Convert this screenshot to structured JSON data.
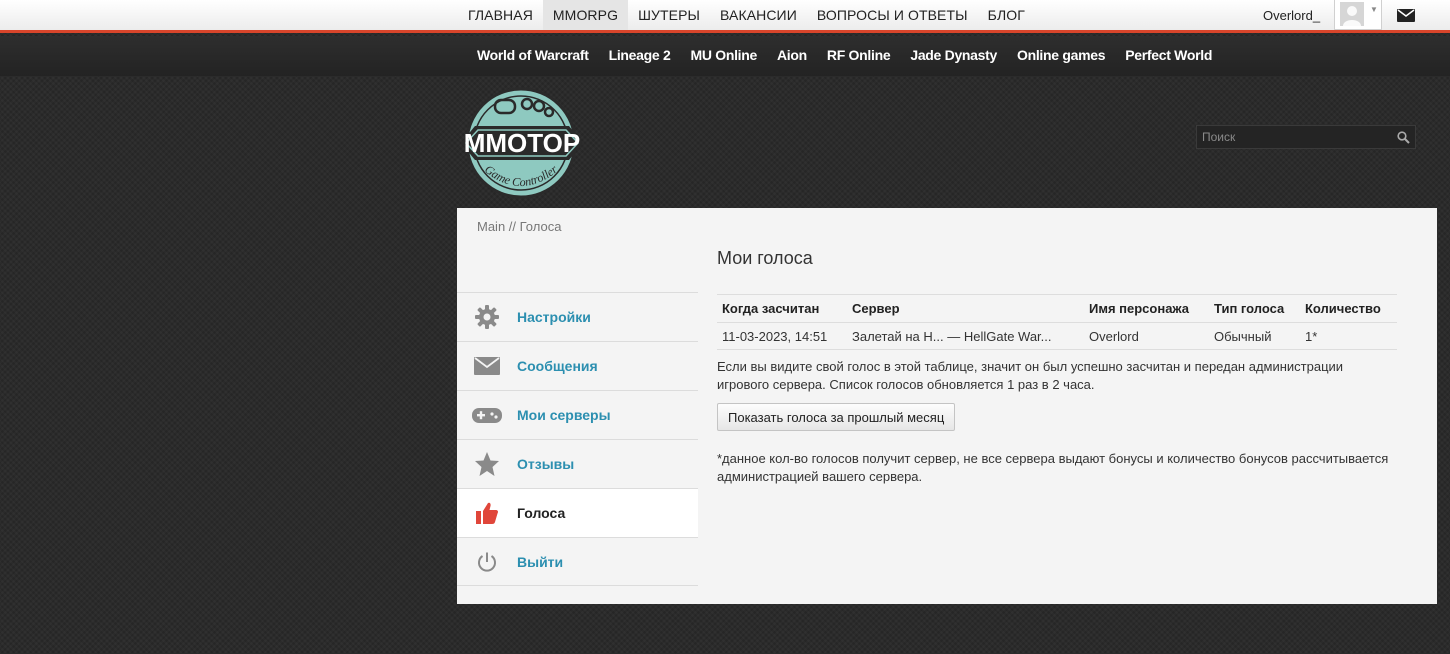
{
  "topnav": {
    "items": [
      {
        "label": "ГЛАВНАЯ",
        "active": false
      },
      {
        "label": "MMORPG",
        "active": true
      },
      {
        "label": "ШУТЕРЫ",
        "active": false
      },
      {
        "label": "ВАКАНСИИ",
        "active": false
      },
      {
        "label": "ВОПРОСЫ И ОТВЕТЫ",
        "active": false
      },
      {
        "label": "БЛОГ",
        "active": false
      }
    ],
    "username": "Overlord_"
  },
  "subnav": {
    "items": [
      "World of Warcraft",
      "Lineage 2",
      "MU Online",
      "Aion",
      "RF Online",
      "Jade Dynasty",
      "Online games",
      "Perfect World"
    ]
  },
  "logo": {
    "text": "MMOTOP",
    "tagline": "Game Controller",
    "colors": {
      "teal": "#8ec9c0",
      "dark": "#2a2a2a"
    }
  },
  "search": {
    "placeholder": "Поиск"
  },
  "breadcrumb": {
    "home": "Main",
    "separator": " // ",
    "current": "Голоса"
  },
  "sidebar": {
    "items": [
      {
        "label": "Настройки",
        "icon": "gear-icon",
        "active": false
      },
      {
        "label": "Сообщения",
        "icon": "envelope-icon",
        "active": false
      },
      {
        "label": "Мои серверы",
        "icon": "gamepad-icon",
        "active": false
      },
      {
        "label": "Отзывы",
        "icon": "star-icon",
        "active": false
      },
      {
        "label": "Голоса",
        "icon": "thumbs-up-icon",
        "active": true
      },
      {
        "label": "Выйти",
        "icon": "power-icon",
        "active": false
      }
    ]
  },
  "main": {
    "title": "Мои голоса",
    "table": {
      "headers": [
        "Когда засчитан",
        "Сервер",
        "Имя персонажа",
        "Тип голоса",
        "Количество"
      ],
      "rows": [
        [
          "11-03-2023, 14:51",
          "Залетай на H... — HellGate War...",
          "Overlord",
          "Обычный",
          "1*"
        ]
      ]
    },
    "note": "Если вы видите свой голос в этой таблице, значит он был успешно засчитан и передан администрации игрового сервера. Список голосов обновляется 1 раз в 2 часа.",
    "prev_month_button": "Показать голоса за прошлый месяц",
    "footnote": "*данное кол-во голосов получит сервер, не все сервера выдают бонусы и количество бонусов рассчитывается администрацией вашего сервера."
  },
  "colors": {
    "accent_red": "#d9452b",
    "link_blue": "#2c8fb0",
    "active_icon_red": "#e0463a"
  }
}
